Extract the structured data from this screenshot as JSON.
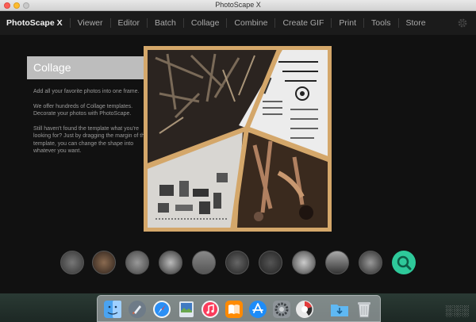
{
  "window": {
    "title": "PhotoScape X"
  },
  "menu": {
    "brand": "PhotoScape X",
    "items": [
      "Viewer",
      "Editor",
      "Batch",
      "Collage",
      "Combine",
      "Create GIF",
      "Print",
      "Tools",
      "Store"
    ]
  },
  "section": {
    "title": "Collage",
    "paragraphs": [
      "Add all your favorite photos into one frame.",
      "We offer hundreds of Collage templates. Decorate your photos with PhotoScape.",
      "Still haven't found the template what you're looking for? Just by dragging the margin of the template, you can change the shape into whatever you want."
    ]
  },
  "thumbnails": [
    "thumb-1",
    "thumb-2",
    "thumb-3",
    "thumb-4",
    "thumb-5",
    "thumb-6",
    "thumb-7",
    "thumb-8",
    "thumb-9",
    "thumb-10"
  ],
  "dock": [
    "finder-icon",
    "launchpad-icon",
    "safari-icon",
    "preview-icon",
    "itunes-icon",
    "ibooks-icon",
    "app-store-icon",
    "system-preferences-icon",
    "photoscape-icon",
    "downloads-folder-icon",
    "trash-icon"
  ],
  "watermark": "░░░",
  "colors": {
    "accent": "#2ec99a",
    "frame": "#d4a76a"
  }
}
